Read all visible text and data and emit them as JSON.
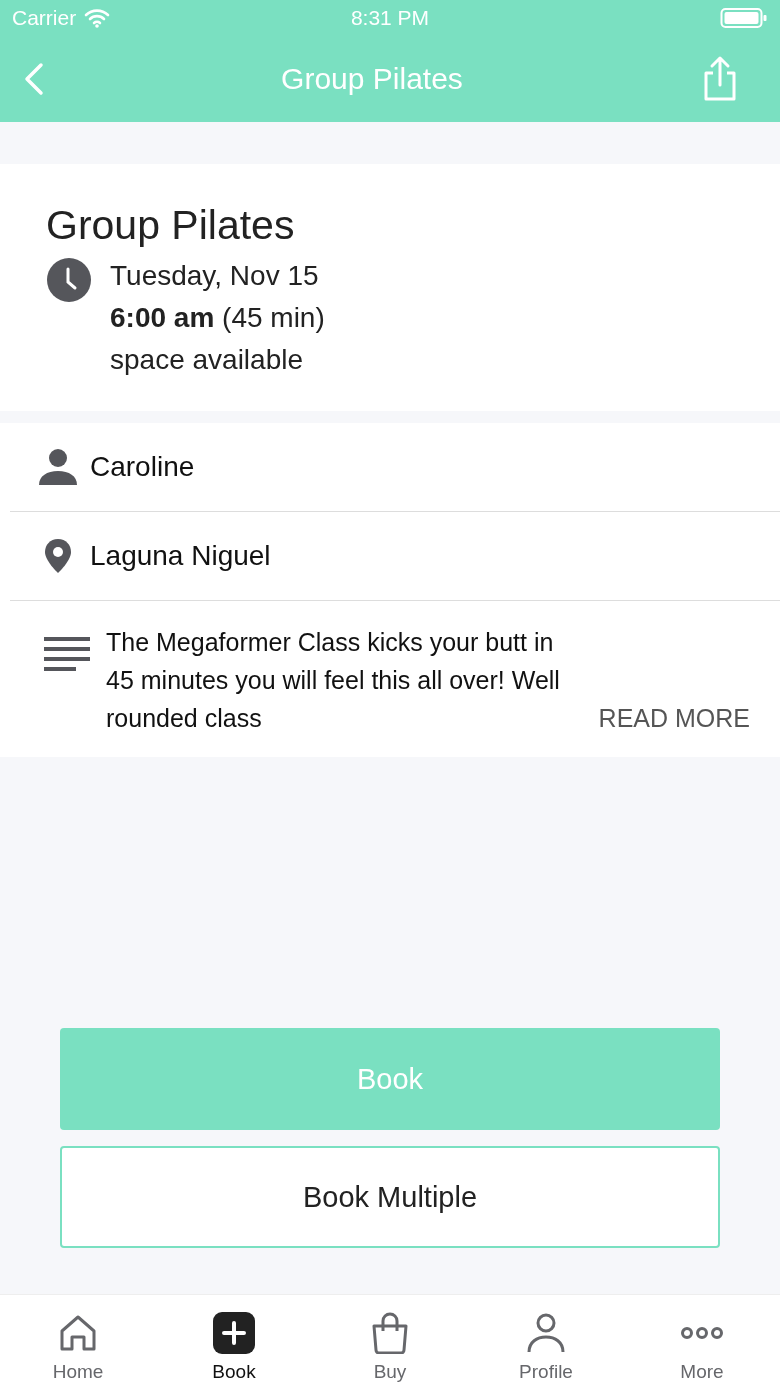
{
  "status_bar": {
    "carrier": "Carrier",
    "time": "8:31 PM"
  },
  "nav": {
    "title": "Group Pilates"
  },
  "class": {
    "title": "Group Pilates",
    "date": "Tuesday, Nov 15",
    "time": "**6:00 am** (45 min)",
    "availability": "space available"
  },
  "details": [
    {
      "kind": "person",
      "text": "Caroline"
    },
    {
      "kind": "location",
      "text": "Laguna Niguel"
    }
  ],
  "description": {
    "text": "The Megaformer Class kicks your butt in 45 minutes you will feel this all over! Well rounded class",
    "more": "READ MORE"
  },
  "buttons": [
    {
      "kind": "primary",
      "label": "Book"
    },
    {
      "kind": "outline",
      "label": "Book Multiple"
    }
  ],
  "tabs": [
    {
      "kind": "home",
      "label": "Home",
      "selected": false
    },
    {
      "kind": "book",
      "label": "Book",
      "selected": true
    },
    {
      "kind": "buy",
      "label": "Buy",
      "selected": false
    },
    {
      "kind": "profile",
      "label": "Profile",
      "selected": false
    },
    {
      "kind": "more",
      "label": "More",
      "selected": false
    }
  ]
}
